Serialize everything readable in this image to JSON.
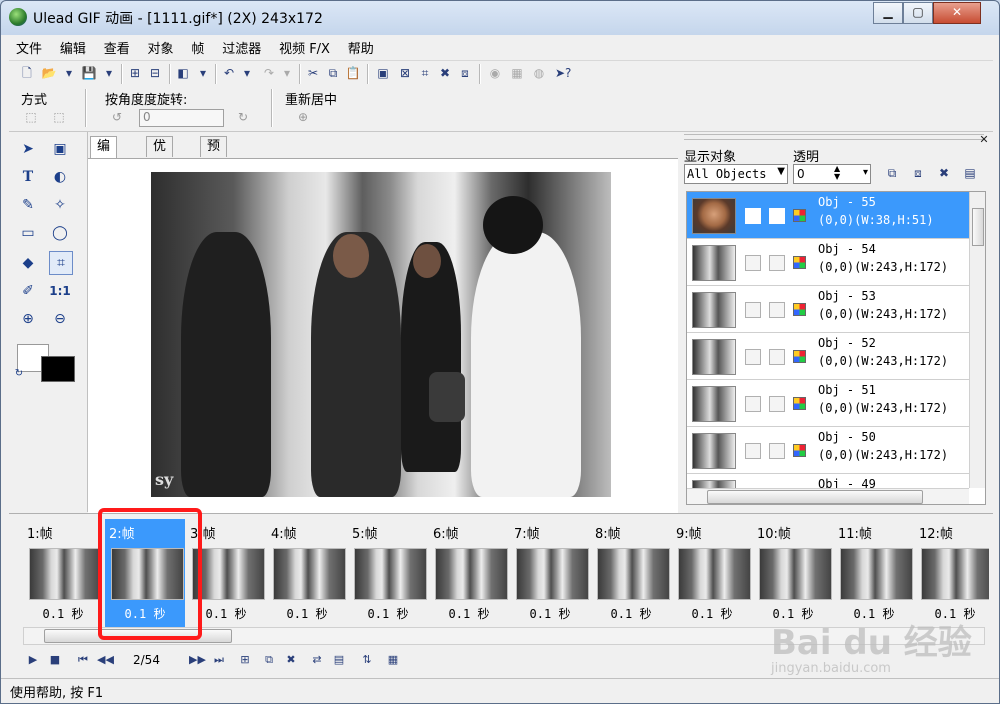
{
  "window": {
    "title": "Ulead GIF 动画 - [1111.gif*] (2X) 243x172",
    "minimize": "▁",
    "maximize": "▢",
    "close": "✕"
  },
  "menu": [
    "文件",
    "编辑",
    "查看",
    "对象",
    "帧",
    "过滤器",
    "视频 F/X",
    "帮助"
  ],
  "propbar": {
    "mode_label": "方式",
    "rotate_label": "按角度度旋转:",
    "rotate_value": "0",
    "recenter_label": "重新居中"
  },
  "editor_tabs": [
    "编辑",
    "优化",
    "预览"
  ],
  "object_panel": {
    "display_label": "显示对象",
    "transparency_label": "透明",
    "filter_value": "All Objects",
    "transparency_value": "0",
    "objects": [
      {
        "name": "Obj - 55",
        "dim": "(0,0)(W:38,H:51)",
        "selected": true
      },
      {
        "name": "Obj - 54",
        "dim": "(0,0)(W:243,H:172)",
        "selected": false
      },
      {
        "name": "Obj - 53",
        "dim": "(0,0)(W:243,H:172)",
        "selected": false
      },
      {
        "name": "Obj - 52",
        "dim": "(0,0)(W:243,H:172)",
        "selected": false
      },
      {
        "name": "Obj - 51",
        "dim": "(0,0)(W:243,H:172)",
        "selected": false
      },
      {
        "name": "Obj - 50",
        "dim": "(0,0)(W:243,H:172)",
        "selected": false
      },
      {
        "name": "Obj - 49",
        "dim": "",
        "selected": false
      }
    ]
  },
  "frames": [
    {
      "label": "1:帧",
      "delay": "0.1 秒"
    },
    {
      "label": "2:帧",
      "delay": "0.1 秒"
    },
    {
      "label": "3:帧",
      "delay": "0.1 秒"
    },
    {
      "label": "4:帧",
      "delay": "0.1 秒"
    },
    {
      "label": "5:帧",
      "delay": "0.1 秒"
    },
    {
      "label": "6:帧",
      "delay": "0.1 秒"
    },
    {
      "label": "7:帧",
      "delay": "0.1 秒"
    },
    {
      "label": "8:帧",
      "delay": "0.1 秒"
    },
    {
      "label": "9:帧",
      "delay": "0.1 秒"
    },
    {
      "label": "10:帧",
      "delay": "0.1 秒"
    },
    {
      "label": "11:帧",
      "delay": "0.1 秒"
    },
    {
      "label": "12:帧",
      "delay": "0.1 秒"
    }
  ],
  "playback": {
    "frame_counter": "2/54"
  },
  "status": {
    "text": "使用帮助, 按 F1"
  },
  "canvas": {
    "watermark_text": "sy"
  },
  "watermark": {
    "brand": "Bai du 经验",
    "url": "jingyan.baidu.com"
  },
  "colors": {
    "selection": "#3b99fc",
    "highlight_box": "#ff1a1a"
  }
}
